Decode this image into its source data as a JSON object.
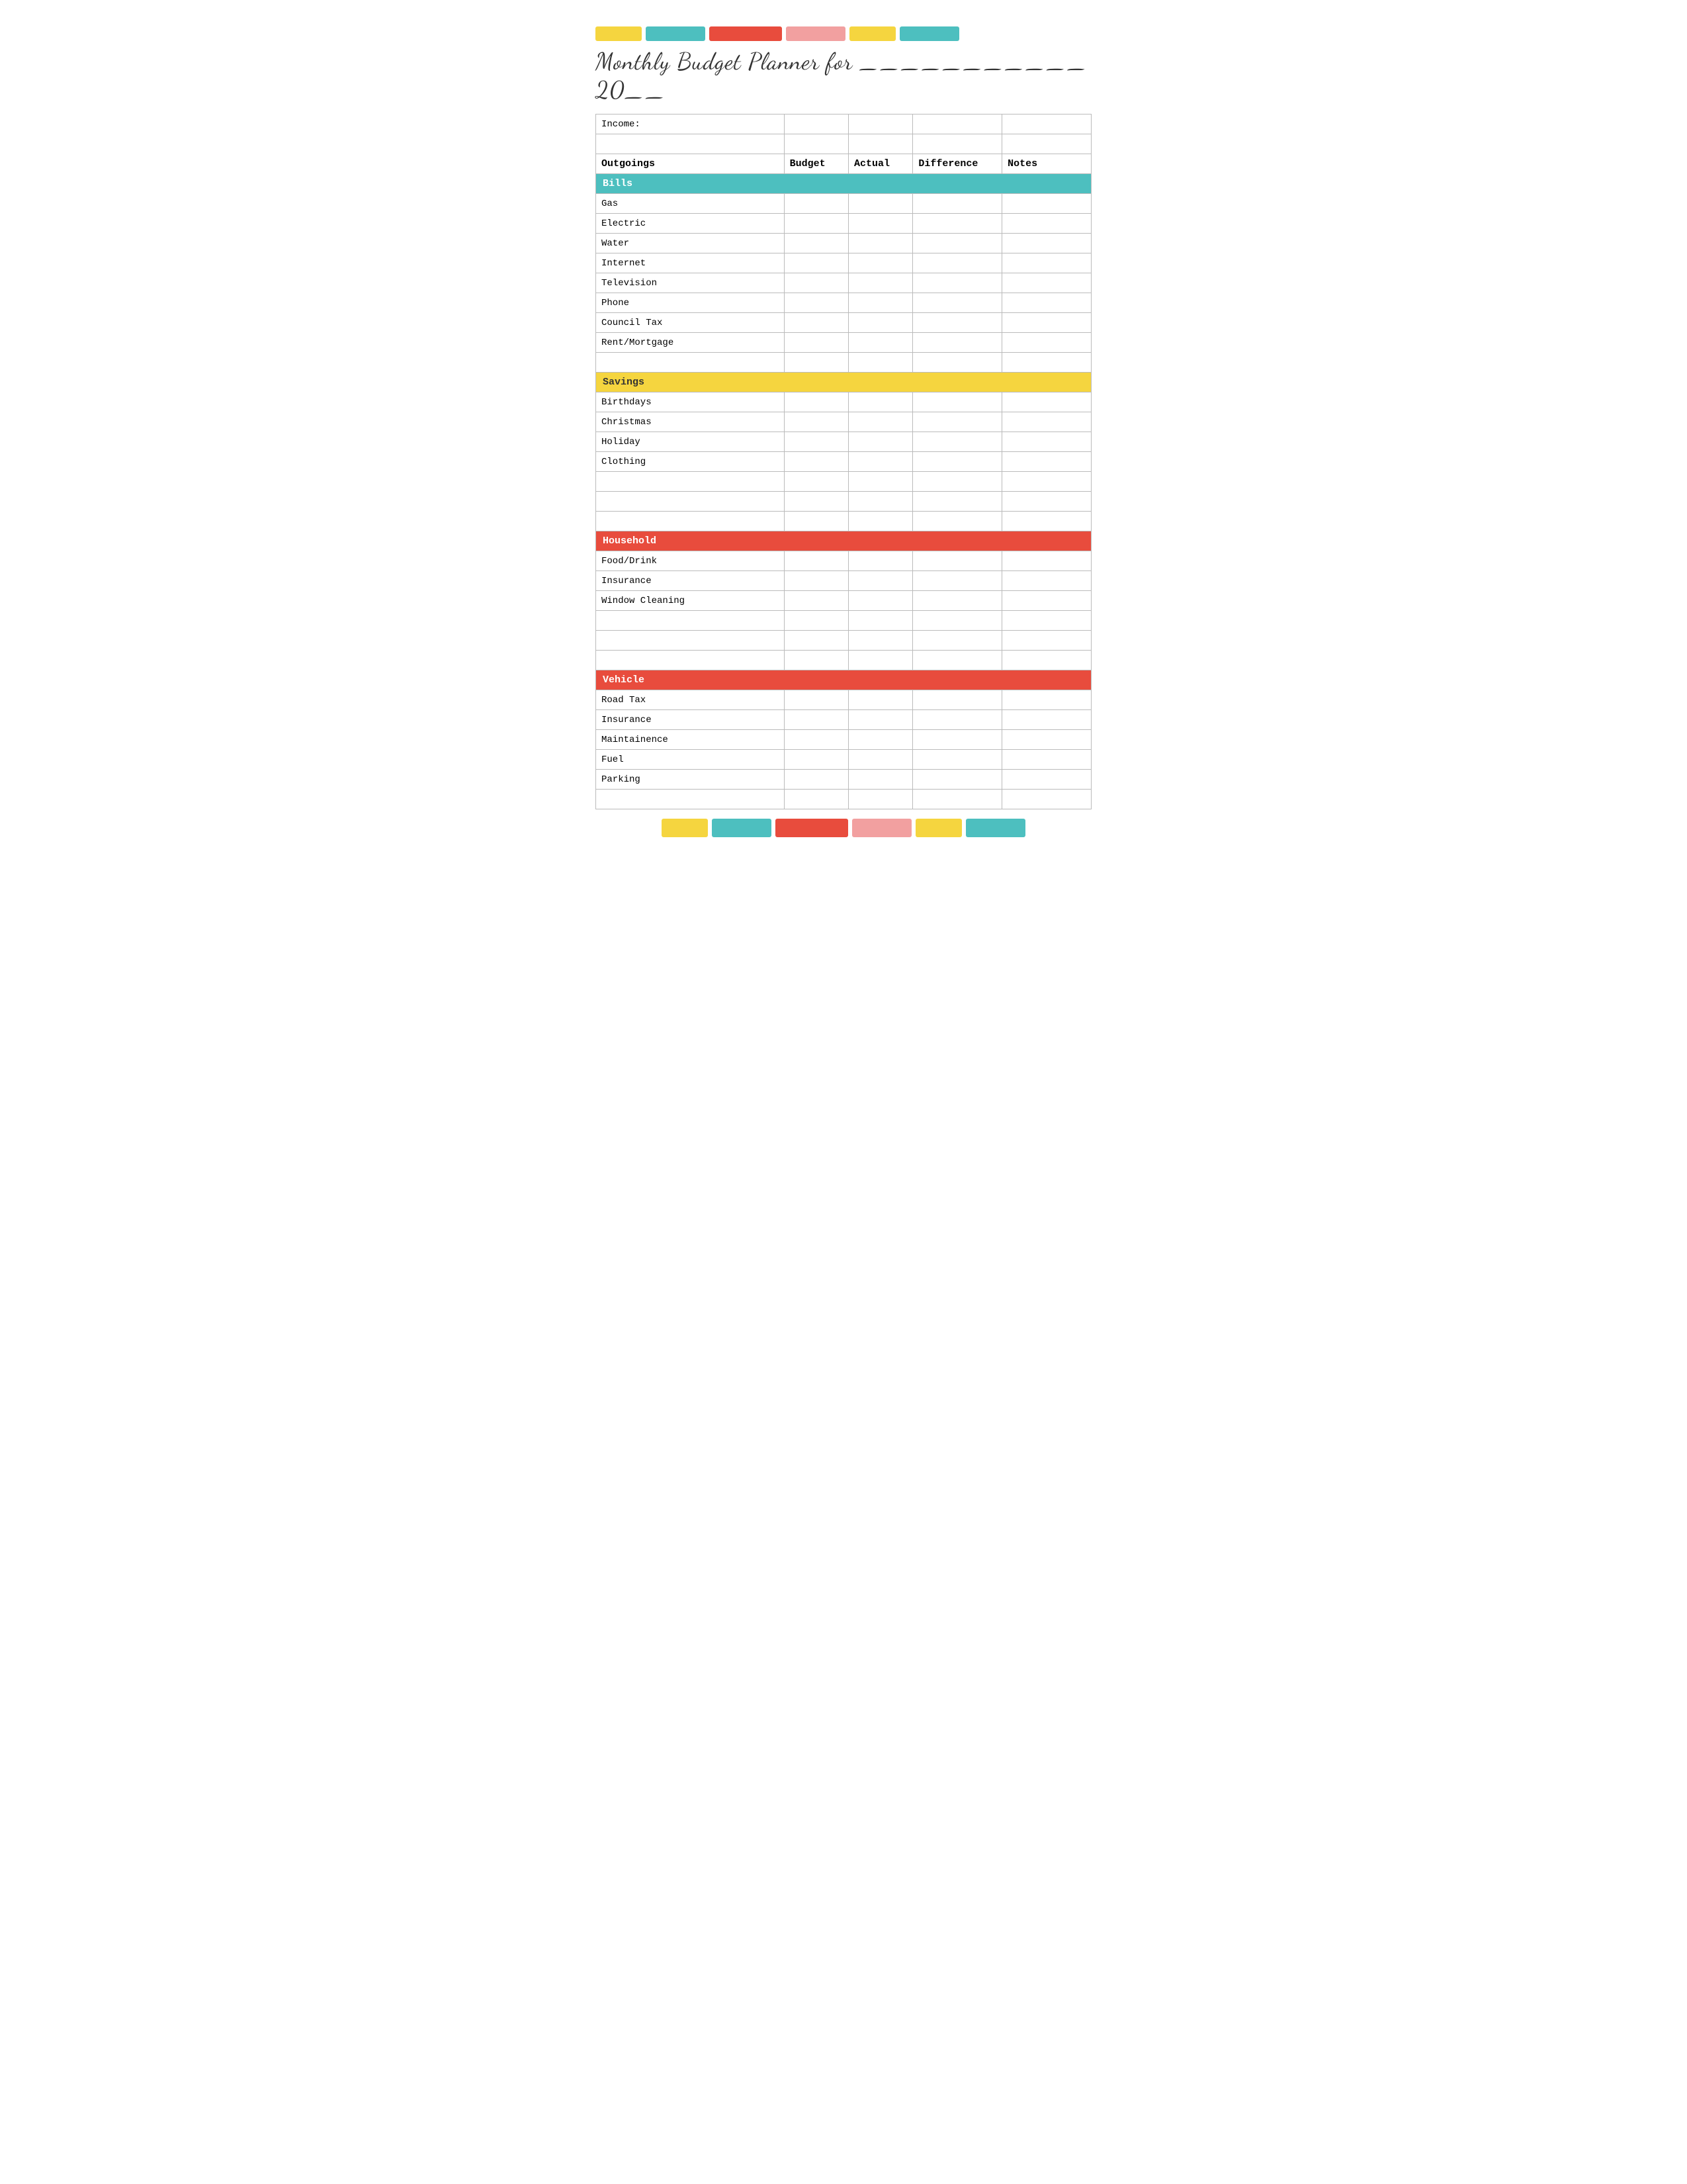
{
  "topBars": [
    {
      "color": "#f5d53f",
      "width": 70
    },
    {
      "color": "#4dbfbf",
      "width": 90
    },
    {
      "color": "#e84c3d",
      "width": 110
    },
    {
      "color": "#f2a0a0",
      "width": 90
    },
    {
      "color": "#f5d53f",
      "width": 70
    },
    {
      "color": "#4dbfbf",
      "width": 90
    }
  ],
  "bottomBars": [
    {
      "color": "#f5d53f",
      "width": 70
    },
    {
      "color": "#4dbfbf",
      "width": 90
    },
    {
      "color": "#e84c3d",
      "width": 110
    },
    {
      "color": "#f2a0a0",
      "width": 90
    },
    {
      "color": "#f5d53f",
      "width": 70
    },
    {
      "color": "#4dbfbf",
      "width": 90
    }
  ],
  "title": "Monthly Budget Planner for ___________ 20__",
  "columns": {
    "label": "",
    "budget": "Budget",
    "actual": "Actual",
    "difference": "Difference",
    "notes": "Notes"
  },
  "sections": {
    "income": "Income:",
    "bills": "Bills",
    "savings": "Savings",
    "household": "Household",
    "vehicle": "Vehicle"
  },
  "billsItems": [
    "Gas",
    "Electric",
    "Water",
    "Internet",
    "Television",
    "Phone",
    "Council Tax",
    "Rent/Mortgage"
  ],
  "savingsItems": [
    "Birthdays",
    "Christmas",
    "Holiday",
    "Clothing"
  ],
  "householdItems": [
    "Food/Drink",
    "Insurance",
    "Window Cleaning"
  ],
  "vehicleItems": [
    "Road Tax",
    "Insurance",
    "Maintainence",
    "Fuel",
    "Parking"
  ]
}
